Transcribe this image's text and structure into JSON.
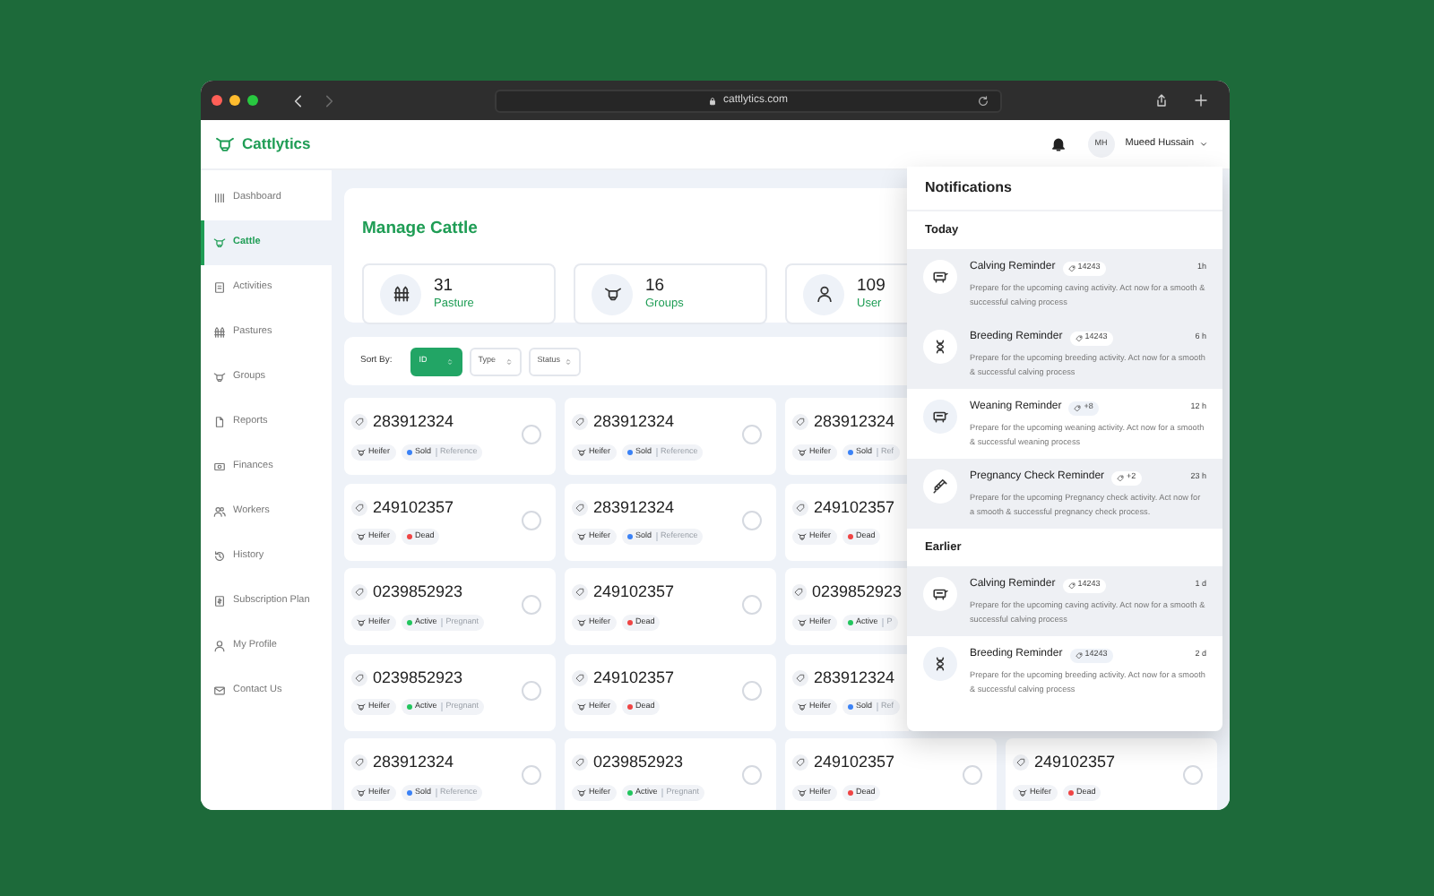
{
  "browser": {
    "url": "cattlytics.com"
  },
  "app": {
    "logo": "Cattlytics",
    "user": {
      "initials": "MH",
      "name": "Mueed Hussain"
    }
  },
  "sidebar": {
    "items": [
      {
        "label": "Dashboard",
        "selected": false
      },
      {
        "label": "Cattle",
        "selected": true
      },
      {
        "label": "Activities",
        "selected": false
      },
      {
        "label": "Pastures",
        "selected": false
      },
      {
        "label": "Groups",
        "selected": false
      },
      {
        "label": "Reports",
        "selected": false
      },
      {
        "label": "Finances",
        "selected": false
      },
      {
        "label": "Workers",
        "selected": false
      },
      {
        "label": "History",
        "selected": false
      },
      {
        "label": "Subscription Plan",
        "selected": false
      },
      {
        "label": "My Profile",
        "selected": false
      },
      {
        "label": "Contact Us",
        "selected": false
      }
    ]
  },
  "page": {
    "title": "Manage Cattle",
    "stats": [
      {
        "value": "31",
        "label": "Pasture"
      },
      {
        "value": "16",
        "label": "Groups"
      },
      {
        "value": "109",
        "label": "User"
      }
    ]
  },
  "sort": {
    "label": "Sort By:",
    "options": [
      {
        "label": "ID",
        "selected": true
      },
      {
        "label": "Type",
        "selected": false
      },
      {
        "label": "Status",
        "selected": false
      }
    ]
  },
  "cattle": {
    "rows": [
      [
        {
          "id": "283912324",
          "type": "Heifer",
          "status": "Sold",
          "color": "#3b82f6",
          "note": "Reference",
          "selected": false,
          "partial": false
        },
        {
          "id": "283912324",
          "type": "Heifer",
          "status": "Sold",
          "color": "#3b82f6",
          "note": "Reference",
          "selected": false,
          "partial": false
        },
        {
          "id": "283912324",
          "type": "Heifer",
          "status": "Sold",
          "color": "#3b82f6",
          "note": "Ref",
          "partial": true
        }
      ],
      [
        {
          "id": "249102357",
          "type": "Heifer",
          "status": "Dead",
          "color": "#ef4444",
          "selected": false,
          "partial": false
        },
        {
          "id": "283912324",
          "type": "Heifer",
          "status": "Sold",
          "color": "#3b82f6",
          "note": "Reference",
          "selected": false,
          "partial": false
        },
        {
          "id": "249102357",
          "type": "Heifer",
          "status": "Dead",
          "color": "#ef4444",
          "partial": true
        }
      ],
      [
        {
          "id": "0239852923",
          "type": "Heifer",
          "status": "Active",
          "color": "#22c55e",
          "note": "Pregnant",
          "selected": false,
          "partial": false
        },
        {
          "id": "249102357",
          "type": "Heifer",
          "status": "Dead",
          "color": "#ef4444",
          "selected": false,
          "partial": false
        },
        {
          "id": "0239852923",
          "type": "Heifer",
          "status": "Active",
          "color": "#22c55e",
          "note": "P",
          "partial": true
        }
      ],
      [
        {
          "id": "0239852923",
          "type": "Heifer",
          "status": "Active",
          "color": "#22c55e",
          "note": "Pregnant",
          "selected": false,
          "partial": false
        },
        {
          "id": "249102357",
          "type": "Heifer",
          "status": "Dead",
          "color": "#ef4444",
          "selected": false,
          "partial": false
        },
        {
          "id": "283912324",
          "type": "Heifer",
          "status": "Sold",
          "color": "#3b82f6",
          "note": "Ref",
          "partial": true
        }
      ],
      [
        {
          "id": "283912324",
          "type": "Heifer",
          "status": "Sold",
          "color": "#3b82f6",
          "note": "Reference",
          "selected": false,
          "partial": false
        },
        {
          "id": "0239852923",
          "type": "Heifer",
          "status": "Active",
          "color": "#22c55e",
          "note": "Pregnant",
          "selected": false,
          "partial": false
        },
        {
          "id": "249102357",
          "type": "Heifer",
          "status": "Dead",
          "color": "#ef4444",
          "selected": false,
          "partial": false
        },
        {
          "id": "249102357",
          "type": "Heifer",
          "status": "Dead",
          "color": "#ef4444",
          "selected": false,
          "partial": false
        }
      ]
    ]
  },
  "notifications": {
    "title": "Notifications",
    "groups": [
      {
        "label": "Today",
        "items": [
          {
            "kind": "calving",
            "title": "Calving Reminder",
            "tag": "14243",
            "time": "1h",
            "message": "Prepare for the upcoming caving activity. Act now for a smooth & successful calving process",
            "unread": true
          },
          {
            "kind": "breeding",
            "title": "Breeding Reminder",
            "tag": "14243",
            "time": "6 h",
            "message": "Prepare for the upcoming breeding activity. Act now for a smooth & successful calving process",
            "unread": true
          },
          {
            "kind": "weaning",
            "title": "Weaning Reminder",
            "tag": "+8",
            "time": "12 h",
            "message": "Prepare for the upcoming weaning activity. Act now for a smooth & successful weaning process",
            "unread": false
          },
          {
            "kind": "pregnancy",
            "title": "Pregnancy Check Reminder",
            "tag": "+2",
            "time": "23 h",
            "message": "Prepare for the upcoming Pregnancy check activity. Act now for a smooth & successful pregnancy check process.",
            "unread": true
          }
        ]
      },
      {
        "label": "Earlier",
        "items": [
          {
            "kind": "calving",
            "title": "Calving Reminder",
            "tag": "14243",
            "time": "1 d",
            "message": "Prepare for the upcoming caving activity. Act now for a smooth & successful calving process",
            "unread": true
          },
          {
            "kind": "breeding",
            "title": "Breeding Reminder",
            "tag": "14243",
            "time": "2 d",
            "message": "Prepare for the upcoming breeding activity. Act now for a smooth & successful calving process",
            "unread": false
          }
        ]
      }
    ]
  }
}
